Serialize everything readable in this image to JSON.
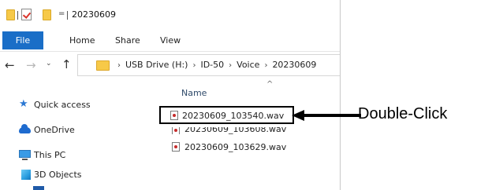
{
  "window": {
    "title": "20230609",
    "qa_dropdown": "="
  },
  "ribbon": {
    "tabs": [
      "File",
      "Home",
      "Share",
      "View"
    ]
  },
  "nav": {
    "back_icon": "←",
    "forward_icon": "→",
    "recent_icon": "⌄",
    "up_icon": "↑"
  },
  "address": {
    "crumbs": [
      "USB Drive (H:)",
      "ID-50",
      "Voice",
      "20230609"
    ],
    "chevron": "›"
  },
  "navpane": {
    "items": [
      {
        "label": "Quick access",
        "icon": "star-icon"
      },
      {
        "label": "OneDrive",
        "icon": "cloud-icon"
      },
      {
        "label": "This PC",
        "icon": "computer-icon"
      },
      {
        "label": "3D Objects",
        "icon": "cube-icon"
      }
    ]
  },
  "filelist": {
    "column_header": "Name",
    "sort_icon": "^",
    "files": [
      "20230609_103540.wav",
      "20230609_103608.wav",
      "20230609_103629.wav"
    ]
  },
  "callout": {
    "text": "Double-Click"
  },
  "colors": {
    "accent": "#1a6ec7",
    "folder": "#f7c948"
  }
}
